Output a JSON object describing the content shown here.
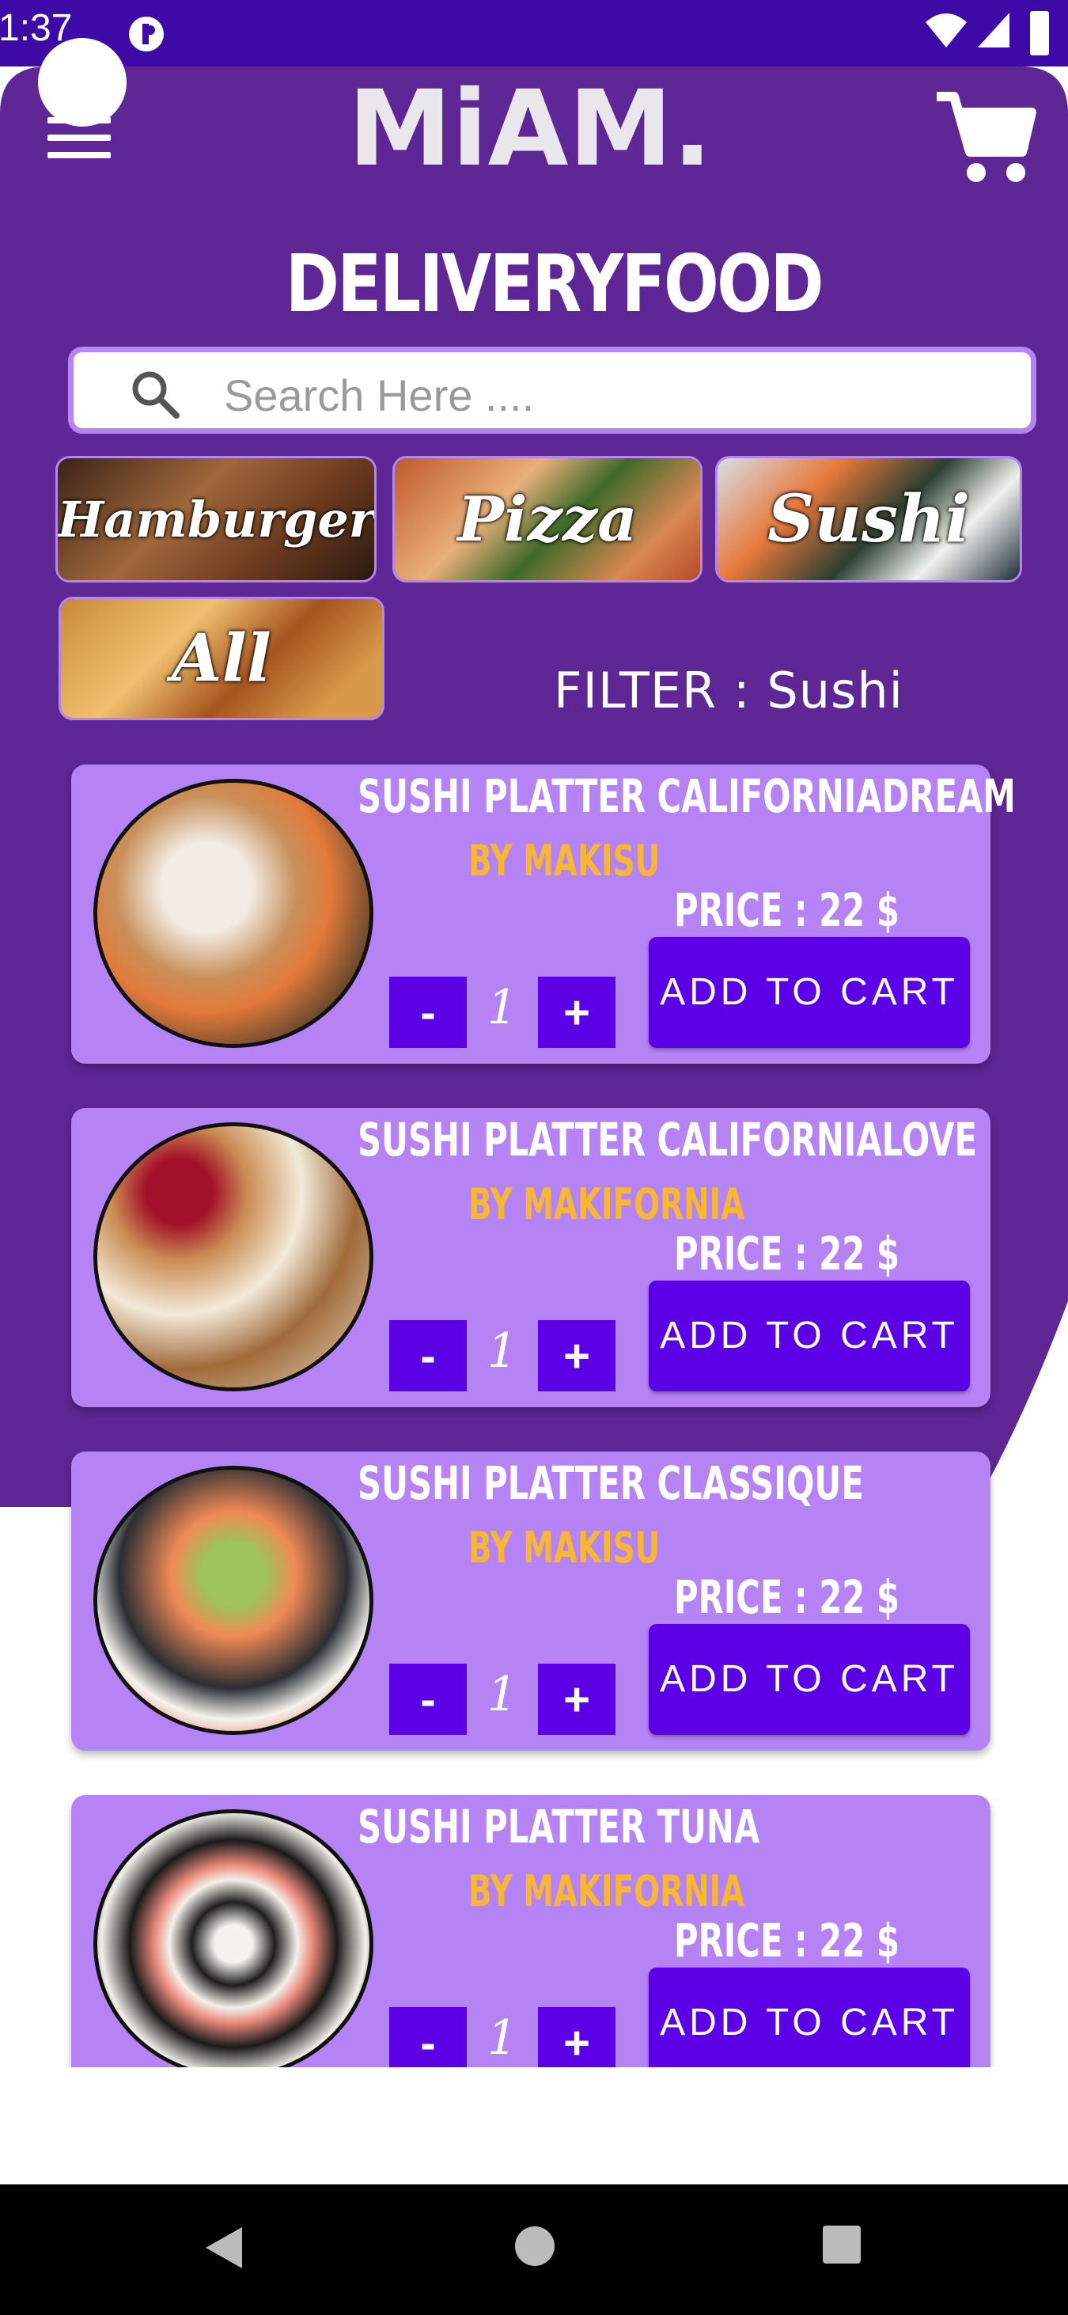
{
  "status_bar": {
    "time": "1:37"
  },
  "header": {
    "logo_text": "MiAM.",
    "brand_title": "DELIVERYFOOD"
  },
  "search": {
    "placeholder": "Search Here ...."
  },
  "categories": [
    {
      "label": "Hamburger"
    },
    {
      "label": "Pizza"
    },
    {
      "label": "Sushi"
    },
    {
      "label": "All"
    }
  ],
  "filter": {
    "text": "FILTER : Sushi"
  },
  "products": [
    {
      "name": "SUSHI PLATTER CALIFORNIADREAM",
      "maker": "BY MAKISU",
      "price": "PRICE :  22 $",
      "qty": "1",
      "minus": "-",
      "plus": "+",
      "add_label": "ADD TO CART"
    },
    {
      "name": "SUSHI PLATTER CALIFORNIALOVE",
      "maker": "BY MAKIFORNIA",
      "price": "PRICE :  22 $",
      "qty": "1",
      "minus": "-",
      "plus": "+",
      "add_label": "ADD TO CART"
    },
    {
      "name": "SUSHI PLATTER CLASSIQUE",
      "maker": "BY MAKISU",
      "price": "PRICE :  22 $",
      "qty": "1",
      "minus": "-",
      "plus": "+",
      "add_label": "ADD TO CART"
    },
    {
      "name": "SUSHI PLATTER TUNA",
      "maker": "BY MAKIFORNIA",
      "price": "PRICE :  22 $",
      "qty": "1",
      "minus": "-",
      "plus": "+",
      "add_label": "ADD TO CART"
    }
  ],
  "colors": {
    "status_bar": "#3d0aa8",
    "header_purple": "#5f2696",
    "card_bg": "#b683f5",
    "button": "#5c00e6",
    "maker_text": "#f7b733"
  },
  "icons": [
    "menu-icon",
    "cart-icon",
    "search-icon",
    "back-icon",
    "home-icon",
    "recents-icon",
    "wifi-icon",
    "signal-icon",
    "battery-icon"
  ]
}
